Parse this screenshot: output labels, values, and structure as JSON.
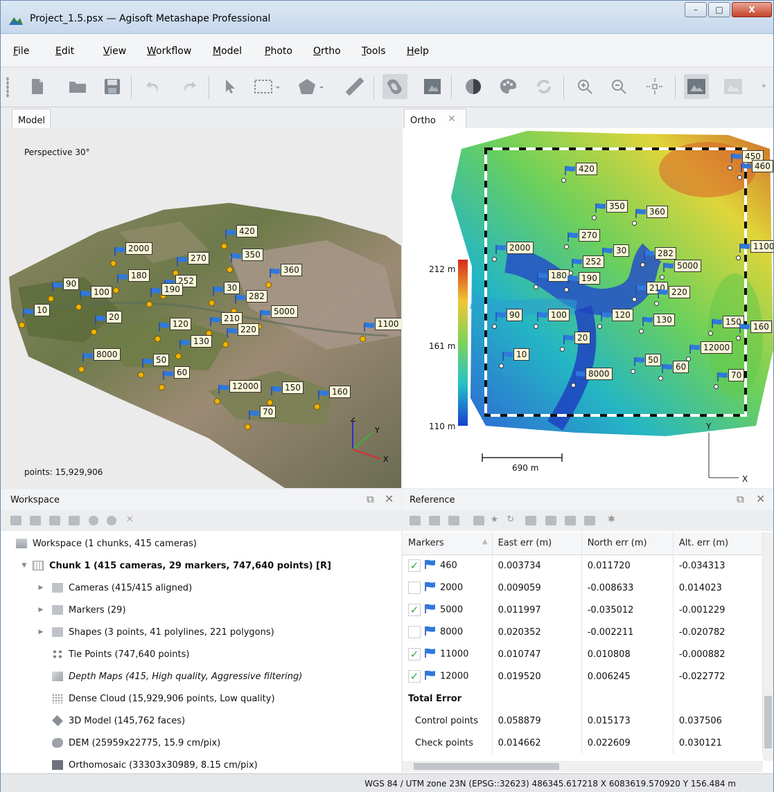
{
  "window": {
    "title": "Project_1.5.psx — Agisoft Metashape Professional",
    "min_label": "–",
    "max_label": "□",
    "close_label": "X"
  },
  "menu": [
    "File",
    "Edit",
    "View",
    "Workflow",
    "Model",
    "Photo",
    "Ortho",
    "Tools",
    "Help"
  ],
  "toolbar": {
    "icons": [
      "new-icon",
      "open-icon",
      "save-icon",
      "undo-icon",
      "redo-icon",
      "navigation-icon",
      "rect-select-icon",
      "polygon-icon",
      "ruler-icon",
      "show-dem-icon",
      "show-ortho-icon",
      "contrast-icon",
      "palette-icon",
      "refresh-icon",
      "zoom-in-icon",
      "zoom-out-icon",
      "reset-view-icon",
      "show-images-icon",
      "show-aligned-icon"
    ],
    "more": "»"
  },
  "model_pane": {
    "tab": "Model",
    "projection": "Perspective 30°",
    "points": "points: 15,929,906",
    "axes": [
      "Z",
      "Y",
      "X"
    ],
    "markers": [
      "420",
      "2000",
      "270",
      "350",
      "180",
      "252",
      "360",
      "90",
      "190",
      "30",
      "282",
      "100",
      "10",
      "20",
      "210",
      "5000",
      "120",
      "220",
      "1100",
      "130",
      "8000",
      "50",
      "60",
      "150",
      "12000",
      "160",
      "70"
    ]
  },
  "ortho_pane": {
    "tab": "Ortho",
    "legend": {
      "max": "212 m",
      "mid": "161 m",
      "min": "110 m"
    },
    "scale": "690 m",
    "axes": [
      "Y",
      "X"
    ],
    "markers": [
      "420",
      "450",
      "460",
      "350",
      "360",
      "270",
      "2000",
      "1100",
      "30",
      "282",
      "252",
      "5000",
      "180",
      "190",
      "210",
      "220",
      "90",
      "100",
      "120",
      "130",
      "150",
      "160",
      "20",
      "12000",
      "10",
      "50",
      "60",
      "70",
      "8000"
    ]
  },
  "workspace": {
    "title": "Workspace",
    "root": "Workspace (1 chunks, 415 cameras)",
    "chunk": "Chunk 1 (415 cameras, 29 markers, 747,640 points) [R]",
    "items": [
      {
        "label": "Cameras (415/415 aligned)",
        "expand": true,
        "icon": "folder-icon"
      },
      {
        "label": "Markers (29)",
        "expand": true,
        "icon": "folder-icon"
      },
      {
        "label": "Shapes (3 points, 41 polylines, 221 polygons)",
        "expand": true,
        "icon": "folder-icon"
      },
      {
        "label": "Tie Points (747,640 points)",
        "expand": false,
        "icon": "tie-points-icon"
      },
      {
        "label": "Depth Maps (415, High quality, Aggressive filtering)",
        "expand": false,
        "icon": "depth-maps-icon",
        "italic": true
      },
      {
        "label": "Dense Cloud (15,929,906 points, Low quality)",
        "expand": false,
        "icon": "dense-cloud-icon"
      },
      {
        "label": "3D Model (145,762 faces)",
        "expand": false,
        "icon": "model-icon"
      },
      {
        "label": "DEM (25959x22775, 15.9 cm/pix)",
        "expand": false,
        "icon": "dem-icon"
      },
      {
        "label": "Orthomosaic (33303x30989, 8.15 cm/pix)",
        "expand": false,
        "icon": "orthomosaic-icon"
      }
    ]
  },
  "reference": {
    "title": "Reference",
    "columns": [
      "Markers",
      "East err (m)",
      "North err (m)",
      "Alt. err (m)"
    ],
    "rows": [
      {
        "checked": true,
        "name": "460",
        "east": "0.003734",
        "north": "0.011720",
        "alt": "-0.034313"
      },
      {
        "checked": false,
        "name": "2000",
        "east": "0.009059",
        "north": "-0.008633",
        "alt": "0.014023"
      },
      {
        "checked": true,
        "name": "5000",
        "east": "0.011997",
        "north": "-0.035012",
        "alt": "-0.001229"
      },
      {
        "checked": false,
        "name": "8000",
        "east": "0.020352",
        "north": "-0.002211",
        "alt": "-0.020782"
      },
      {
        "checked": true,
        "name": "11000",
        "east": "0.010747",
        "north": "0.010808",
        "alt": "-0.000882"
      },
      {
        "checked": true,
        "name": "12000",
        "east": "0.019520",
        "north": "0.006245",
        "alt": "-0.022772"
      }
    ],
    "total_label": "Total Error",
    "totals": [
      {
        "name": "Control points",
        "east": "0.058879",
        "north": "0.015173",
        "alt": "0.037506"
      },
      {
        "name": "Check points",
        "east": "0.014662",
        "north": "0.022609",
        "alt": "0.030121"
      }
    ]
  },
  "status": "WGS 84 / UTM zone 23N (EPSG::32623)  486345.617218 X  6083619.570920 Y  156.484 m",
  "colors": {
    "accent": "#1f6fd0",
    "check": "#36a34e",
    "label_bg": "#fbf7d8",
    "marker_dot": "#f3b400"
  }
}
